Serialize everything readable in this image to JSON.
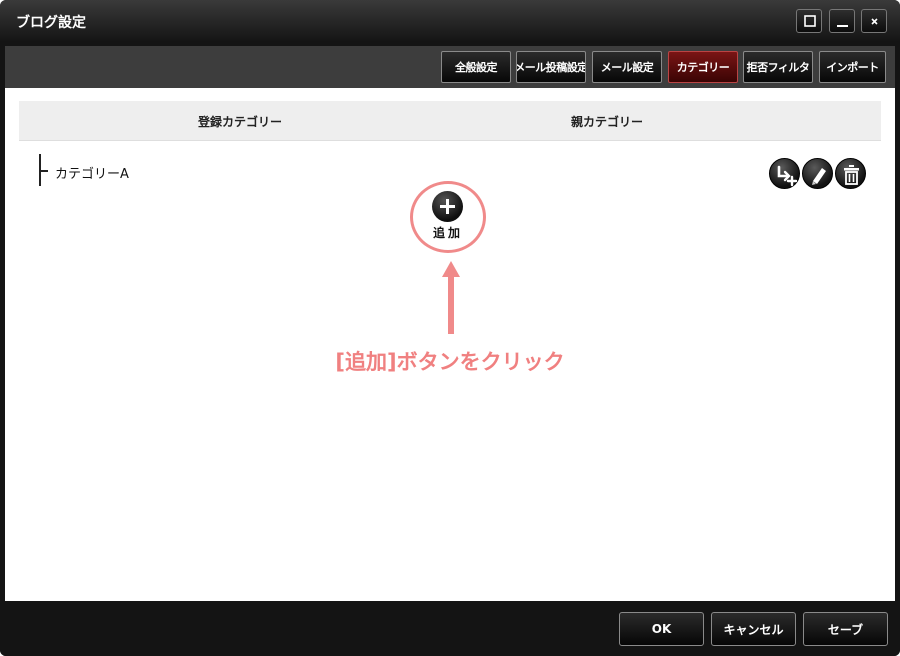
{
  "window": {
    "title": "ブログ設定",
    "controls": [
      "maximize-icon",
      "minimize-icon",
      "close-icon"
    ]
  },
  "tabs": [
    {
      "label": "全般設定",
      "active": false
    },
    {
      "label": "メール投稿設定",
      "active": false
    },
    {
      "label": "メール設定",
      "active": false
    },
    {
      "label": "カテゴリー",
      "active": true
    },
    {
      "label": "拒否フィルタ",
      "active": false
    },
    {
      "label": "インポート",
      "active": false
    }
  ],
  "table": {
    "headers": [
      "登録カテゴリー",
      "親カテゴリー"
    ],
    "rows": [
      {
        "name": "カテゴリーA",
        "actions": [
          "add-subcategory-icon",
          "edit-pencil-icon",
          "trash-icon"
        ]
      }
    ]
  },
  "add_button": {
    "label": "追加",
    "icon": "plus-icon"
  },
  "annotation": {
    "text": "[追加]ボタンをクリック",
    "color": "#f08080"
  },
  "footer": {
    "ok": "OK",
    "cancel": "キャンセル",
    "save": "セーブ"
  },
  "colors": {
    "active_tab": "#6a0e0e",
    "highlight": "#f08a8a"
  }
}
